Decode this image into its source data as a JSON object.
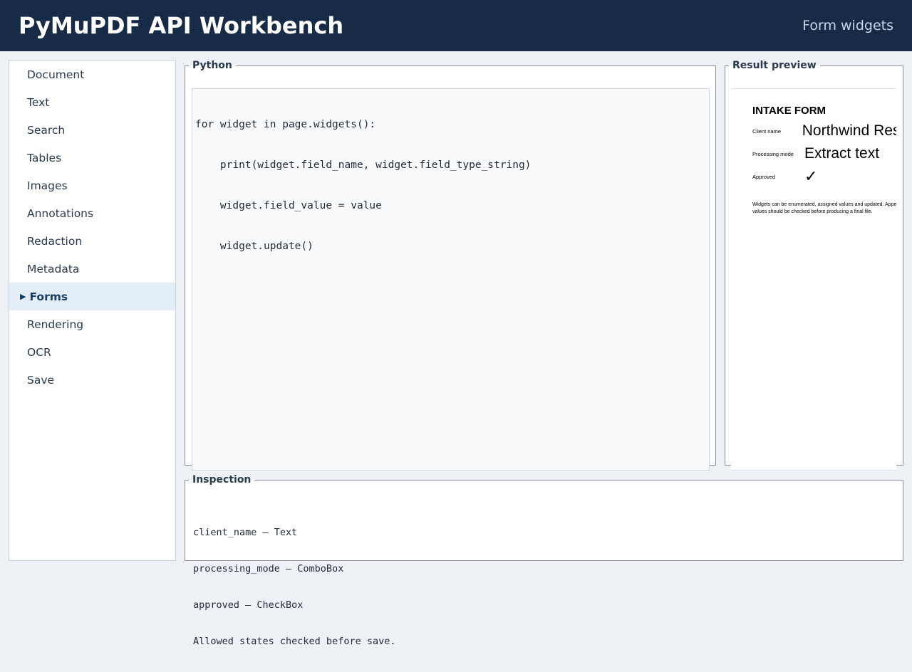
{
  "header": {
    "title": "PyMuPDF API Workbench",
    "section": "Form widgets"
  },
  "sidebar": {
    "items": [
      {
        "label": "Document"
      },
      {
        "label": "Text"
      },
      {
        "label": "Search"
      },
      {
        "label": "Tables"
      },
      {
        "label": "Images"
      },
      {
        "label": "Annotations"
      },
      {
        "label": "Redaction"
      },
      {
        "label": "Metadata"
      },
      {
        "label": "Forms",
        "active": true
      },
      {
        "label": "Rendering"
      },
      {
        "label": "OCR"
      },
      {
        "label": "Save"
      }
    ]
  },
  "python": {
    "legend": "Python",
    "code": [
      "for widget in page.widgets():",
      "    print(widget.field_name, widget.field_type_string)",
      "    widget.field_value = value",
      "    widget.update()"
    ]
  },
  "preview": {
    "legend": "Result preview",
    "heading": "INTAKE FORM",
    "fields": [
      {
        "label": "Client name",
        "value": "Northwind Research"
      },
      {
        "label": "Processing mode",
        "value": "Extract text"
      },
      {
        "label": "Approved",
        "value": "✓"
      }
    ],
    "note_line1": "Widgets can be enumerated, assigned values and updated. Appearance",
    "note_line2": "values should be checked before producing a final file."
  },
  "inspection": {
    "legend": "Inspection",
    "lines": [
      "client_name — Text",
      "processing_mode — ComboBox",
      "approved — CheckBox",
      "Allowed states checked before save."
    ]
  },
  "colors": {
    "header_bg": "#172a46",
    "active_item_bg": "#e4eef8",
    "active_item_text": "#173e66"
  }
}
